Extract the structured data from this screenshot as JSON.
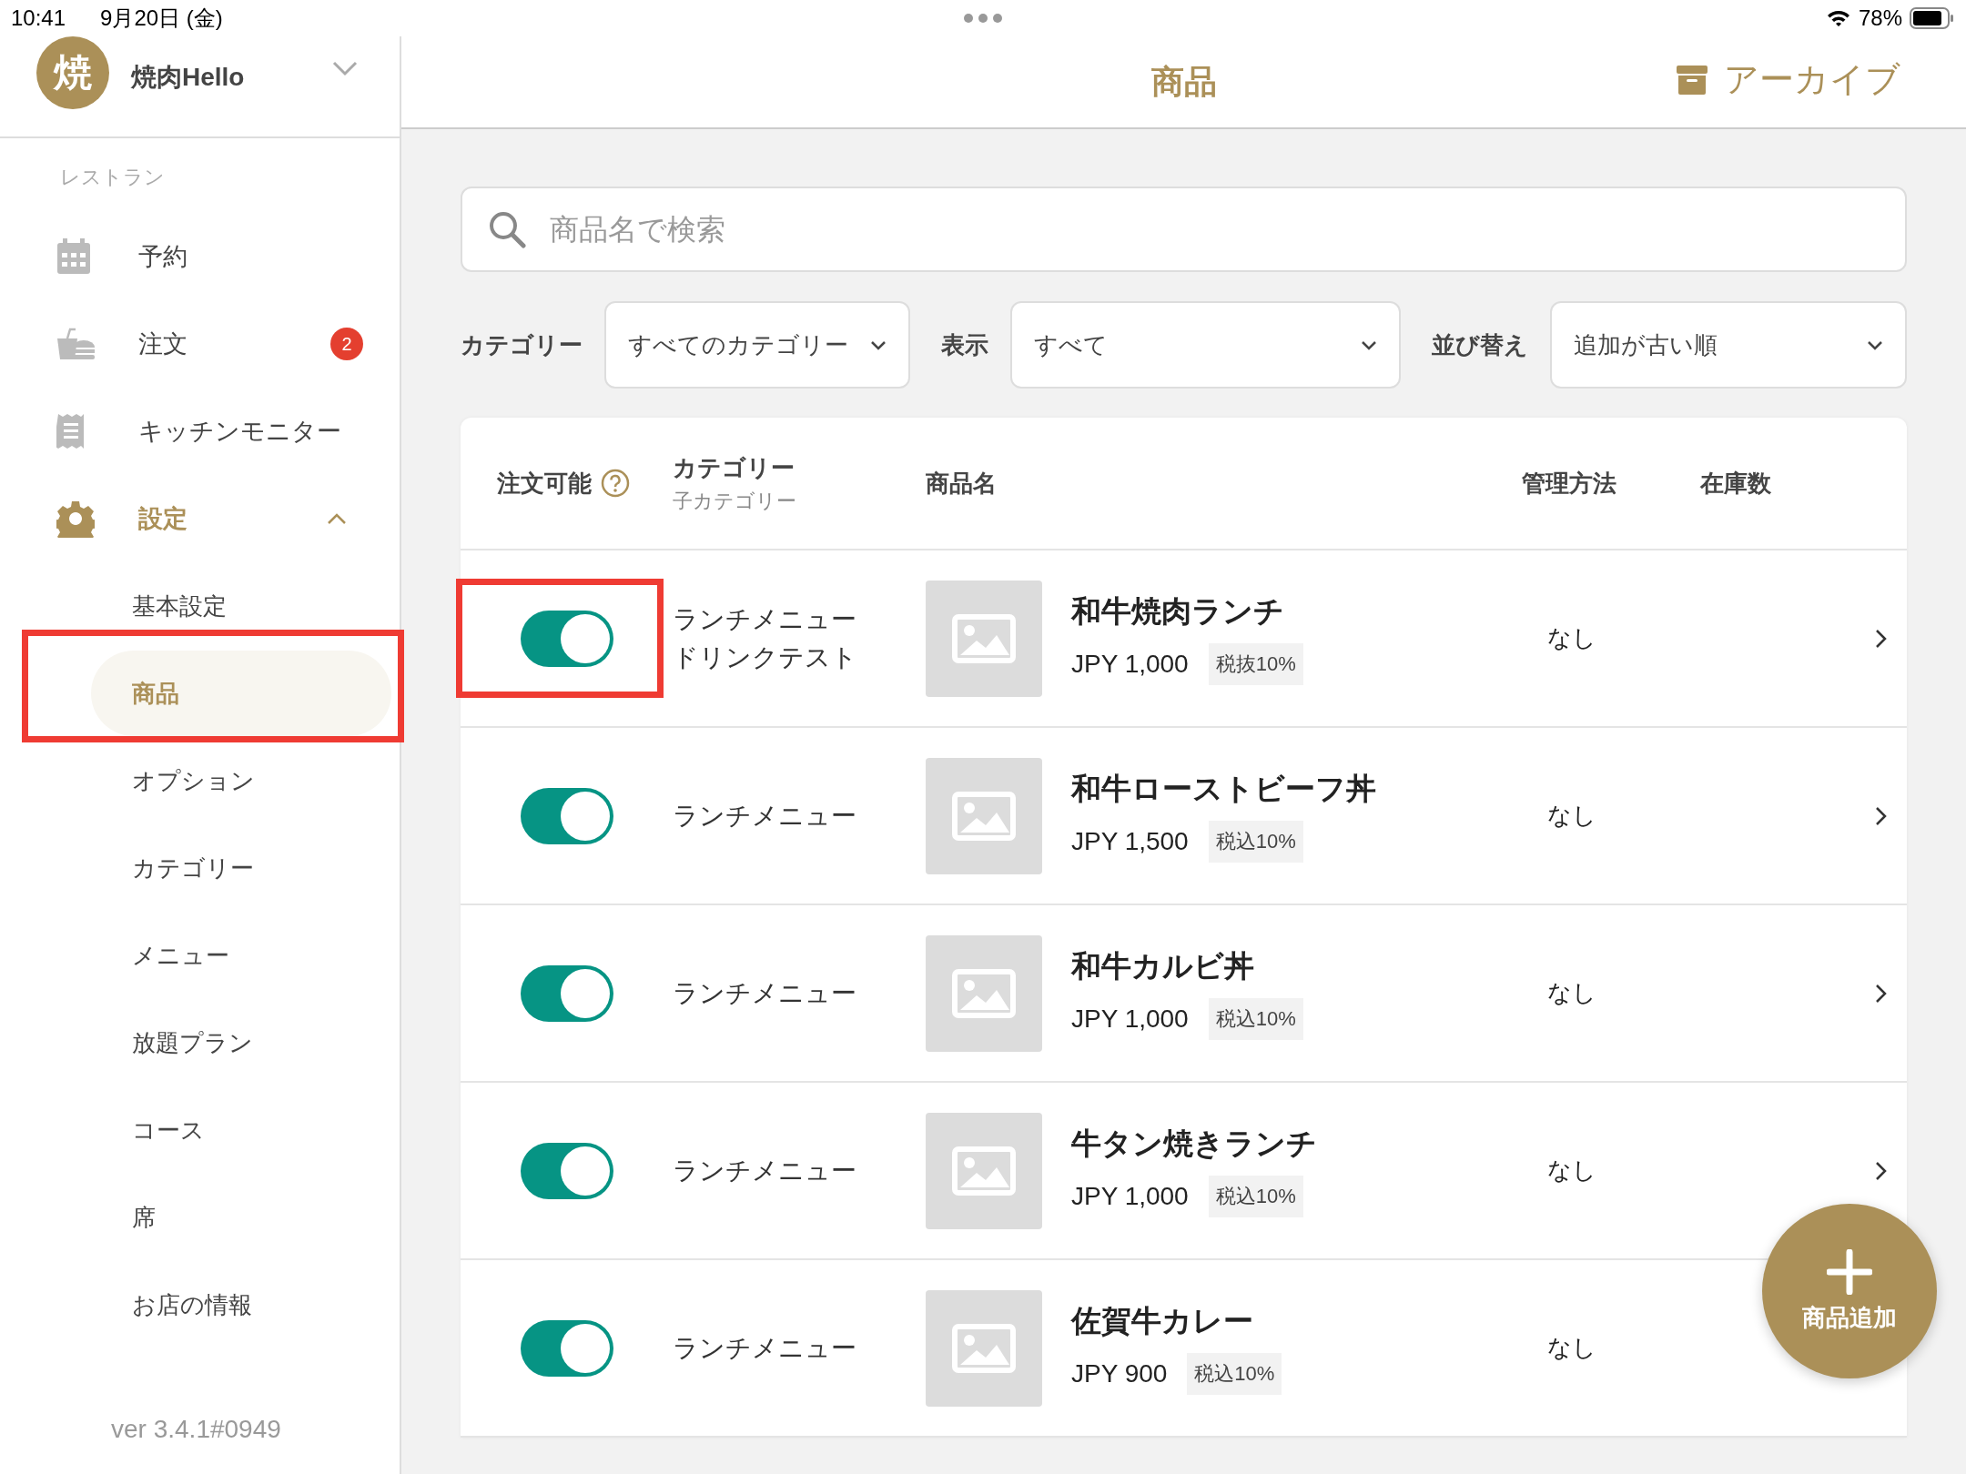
{
  "status_bar": {
    "time": "10:41",
    "date": "9月20日 (金)",
    "battery": "78%"
  },
  "sidebar": {
    "store": {
      "avatar": "焼",
      "name": "焼肉Hello"
    },
    "section": "レストラン",
    "items": [
      {
        "label": "予約",
        "selected": false
      },
      {
        "label": "注文",
        "selected": false,
        "badge": "2"
      },
      {
        "label": "キッチンモニター",
        "selected": false
      },
      {
        "label": "設定",
        "selected": false,
        "expanded": true,
        "children": [
          {
            "label": "基本設定",
            "selected": false,
            "highlighted": false
          },
          {
            "label": "商品",
            "selected": true,
            "highlighted": true
          },
          {
            "label": "オプション",
            "selected": false,
            "highlighted": false
          },
          {
            "label": "カテゴリー",
            "selected": false,
            "highlighted": false
          },
          {
            "label": "メニュー",
            "selected": false,
            "highlighted": false
          },
          {
            "label": "放題プラン",
            "selected": false,
            "highlighted": false
          },
          {
            "label": "コース",
            "selected": false,
            "highlighted": false
          },
          {
            "label": "席",
            "selected": false,
            "highlighted": false
          },
          {
            "label": "お店の情報",
            "selected": false,
            "highlighted": false
          }
        ]
      }
    ],
    "version": "ver 3.4.1#0949"
  },
  "header": {
    "title": "商品",
    "archive_button": "アーカイブ"
  },
  "search": {
    "placeholder": "商品名で検索"
  },
  "filters": [
    {
      "label": "カテゴリー",
      "value": "すべてのカテゴリー"
    },
    {
      "label": "表示",
      "value": "すべて"
    },
    {
      "label": "並び替え",
      "value": "追加が古い順"
    }
  ],
  "table": {
    "columns": [
      {
        "label": "注文可能",
        "help": true
      },
      {
        "label": "カテゴリー",
        "sublabel": "子カテゴリー"
      },
      {
        "label": "商品名"
      },
      {
        "label": "管理方法"
      },
      {
        "label": "在庫数"
      }
    ],
    "rows": [
      {
        "available": true,
        "highlighted": true,
        "category": "ランチメニュー",
        "subcategory": "ドリンクテスト",
        "name": "和牛焼肉ランチ",
        "price": "JPY 1,000",
        "tax": "税抜10%",
        "management": "なし"
      },
      {
        "available": true,
        "highlighted": false,
        "category": "ランチメニュー",
        "name": "和牛ローストビーフ丼",
        "price": "JPY 1,500",
        "tax": "税込10%",
        "management": "なし"
      },
      {
        "available": true,
        "highlighted": false,
        "category": "ランチメニュー",
        "name": "和牛カルビ丼",
        "price": "JPY 1,000",
        "tax": "税込10%",
        "management": "なし"
      },
      {
        "available": true,
        "highlighted": false,
        "category": "ランチメニュー",
        "name": "牛タン焼きランチ",
        "price": "JPY 1,000",
        "tax": "税込10%",
        "management": "なし"
      },
      {
        "available": true,
        "highlighted": false,
        "category": "ランチメニュー",
        "name": "佐賀牛カレー",
        "price": "JPY 900",
        "tax": "税込10%",
        "management": "なし"
      }
    ]
  },
  "fab": {
    "label": "商品追加"
  }
}
